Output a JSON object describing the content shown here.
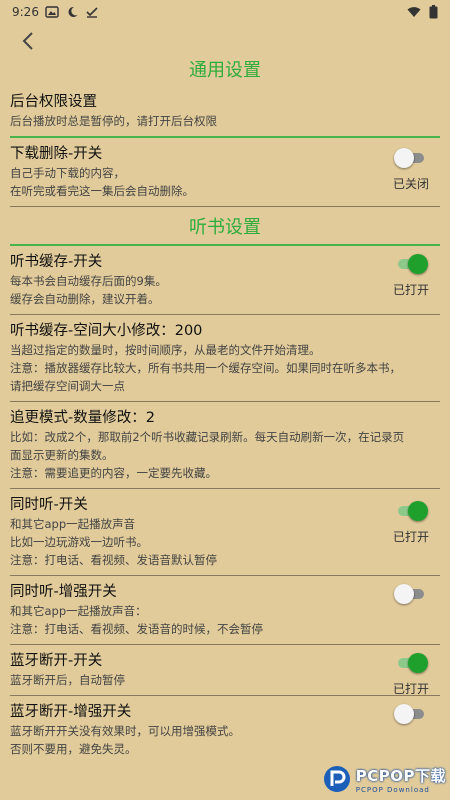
{
  "status_bar": {
    "time": "9:26"
  },
  "sections": {
    "general": "通用设置",
    "listen": "听书设置"
  },
  "items": [
    {
      "title": "后台权限设置",
      "desc": [
        "后台播放时总是暂停的，请打开后台权限"
      ]
    },
    {
      "title": "下载删除-开关",
      "desc": [
        "自己手动下载的内容，",
        "在听完或看完这一集后会自动删除。"
      ],
      "state": "已关闭"
    },
    {
      "title": "听书缓存-开关",
      "desc": [
        "每本书会自动缓存后面的9集。",
        "缓存会自动删除，建议开着。"
      ],
      "state": "已打开"
    },
    {
      "title": "听书缓存-空间大小修改：200",
      "desc": [
        "当超过指定的数量时，按时间顺序，从最老的文件开始清理。",
        "注意：播放器缓存比较大，所有书共用一个缓存空间。如果同时在听多本书，",
        "请把缓存空间调大一点"
      ]
    },
    {
      "title": "追更模式-数量修改：2",
      "desc": [
        "比如：改成2个，那取前2个听书收藏记录刷新。每天自动刷新一次，在记录页",
        "面显示更新的集数。",
        "注意：需要追更的内容，一定要先收藏。"
      ]
    },
    {
      "title": "同时听-开关",
      "desc": [
        "和其它app一起播放声音",
        "比如一边玩游戏一边听书。",
        "注意：打电话、看视频、发语音默认暂停"
      ],
      "state": "已打开"
    },
    {
      "title": "同时听-增强开关",
      "desc": [
        "和其它app一起播放声音：",
        "注意：打电话、看视频、发语音的时候，不会暂停"
      ]
    },
    {
      "title": "蓝牙断开-开关",
      "desc": [
        "蓝牙断开后，自动暂停"
      ],
      "state": "已打开"
    },
    {
      "title": "蓝牙断开-增强开关",
      "desc": [
        "蓝牙断开开关没有效果时，可以用增强模式。",
        "否则不要用，避免失灵。"
      ]
    }
  ],
  "toggles": {
    "download_delete": false,
    "listen_cache": true,
    "simul_listen": true,
    "simul_enhanced": false,
    "bt_disconnect": true,
    "bt_enhanced": false
  },
  "watermark": {
    "main": "PCPOP下载",
    "sub": "PCPOP Download"
  },
  "colors": {
    "background": "#E1CB9A",
    "accent": "#2FAD3C"
  }
}
